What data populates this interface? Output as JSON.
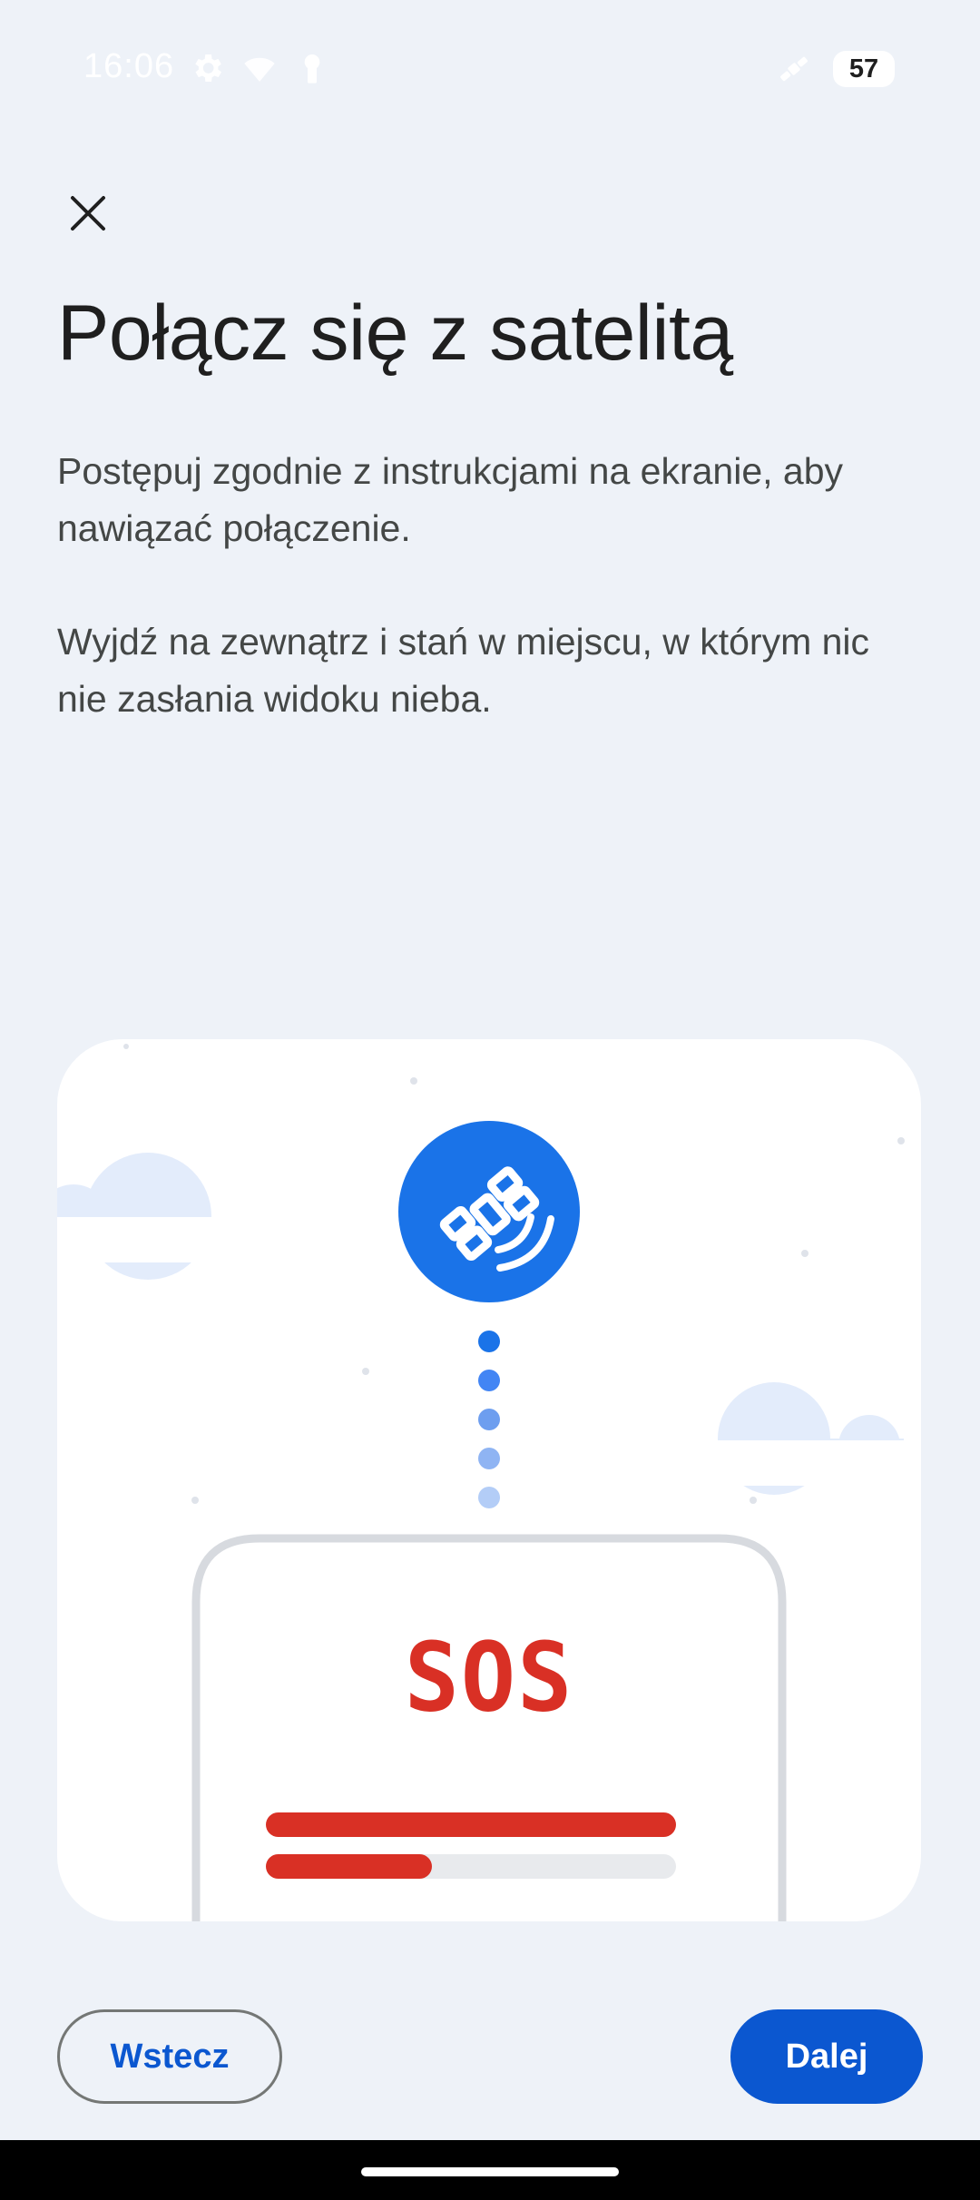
{
  "status_bar": {
    "time": "16:06",
    "battery": "57",
    "icons": [
      "settings-gear-icon",
      "wifi-icon",
      "keyhole-icon",
      "satellite-icon"
    ]
  },
  "close_icon": "close-icon",
  "title": "Połącz się z satelitą",
  "paragraphs": [
    "Postępuj zgodnie z instrukcjami na ekranie, aby nawiązać połączenie.",
    "Wyjdź na zewnątrz i stań w miejscu, w którym nic nie zasłania widoku nieba."
  ],
  "illustration": {
    "icon": "satellite-icon",
    "sos_label": "SOS",
    "colors": {
      "blue": "#1a73e8",
      "red": "#d93025",
      "cloud": "#e3ecfb"
    }
  },
  "buttons": {
    "back": "Wstecz",
    "next": "Dalej"
  }
}
